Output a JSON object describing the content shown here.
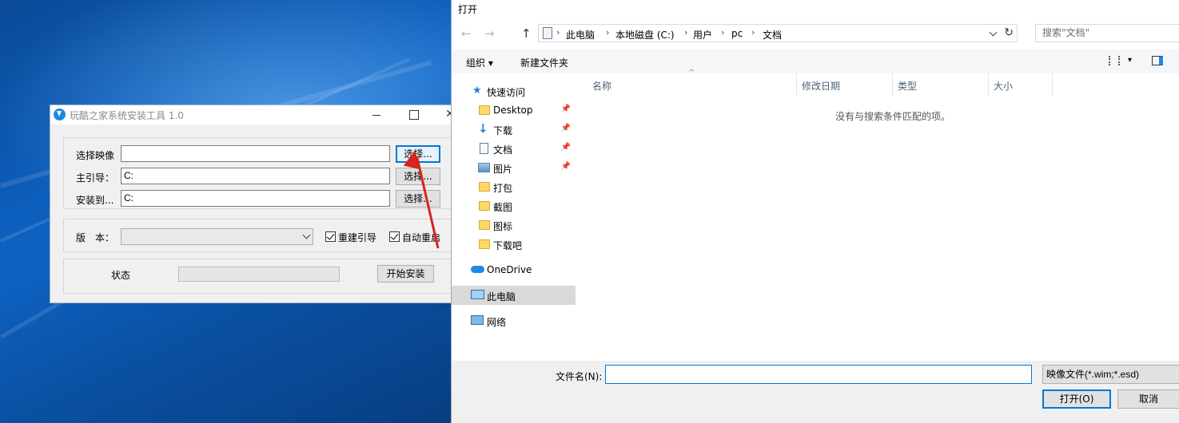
{
  "installer": {
    "title": "玩酷之家系统安装工具 1.0",
    "labels": {
      "select_image": "选择映像",
      "main_boot": "主引导：",
      "install_to": "安装到...",
      "version": "版　本：",
      "status": "状态"
    },
    "values": {
      "select_image": "",
      "main_boot": "C:",
      "install_to": "C:"
    },
    "buttons": {
      "select": "选择...",
      "start": "开始安装"
    },
    "checkboxes": {
      "rebuild_boot": "重建引导",
      "auto_restart": "自动重启"
    },
    "progress": 0
  },
  "open_dialog": {
    "title": "打开",
    "breadcrumb": [
      "此电脑",
      "本地磁盘 (C:)",
      "用户",
      "pc",
      "文档"
    ],
    "search_placeholder": "搜索\"文档\"",
    "toolbar": {
      "organize": "组织",
      "new_folder": "新建文件夹"
    },
    "nav": {
      "quick_access": "快速访问",
      "items": [
        "Desktop",
        "下载",
        "文档",
        "图片",
        "打包",
        "截图",
        "图标",
        "下载吧"
      ],
      "onedrive": "OneDrive",
      "this_pc": "此电脑",
      "network": "网络"
    },
    "columns": [
      "名称",
      "修改日期",
      "类型",
      "大小"
    ],
    "empty_message": "没有与搜索条件匹配的项。",
    "filename_label": "文件名(N):",
    "filename_value": "",
    "filetype": "映像文件(*.wim;*.esd)",
    "buttons": {
      "open": "打开(O)",
      "cancel": "取消"
    }
  },
  "colors": {
    "accent": "#0078d7",
    "arrow_annotation": "#d9231c",
    "desktop": "#0d63c4"
  }
}
